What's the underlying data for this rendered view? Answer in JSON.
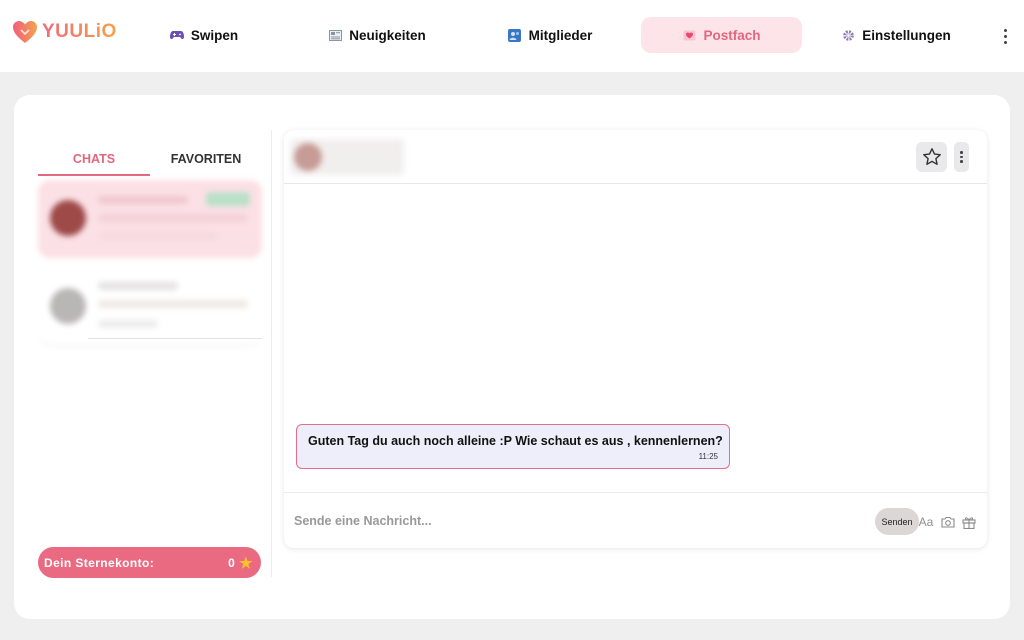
{
  "brand": {
    "name": "YUULiO"
  },
  "nav": {
    "items": [
      {
        "label": "Swipen",
        "icon": "gamepad-icon"
      },
      {
        "label": "Neuigkeiten",
        "icon": "newspaper-icon"
      },
      {
        "label": "Mitglieder",
        "icon": "members-icon"
      },
      {
        "label": "Postfach",
        "icon": "heart-letter-icon",
        "active": true
      },
      {
        "label": "Einstellungen",
        "icon": "gear-icon"
      }
    ]
  },
  "sidebar": {
    "tabs": [
      {
        "label": "CHATS",
        "active": true
      },
      {
        "label": "FAVORITEN",
        "active": false
      }
    ],
    "stars": {
      "label": "Dein Sternekonto:",
      "count": "0"
    }
  },
  "chat": {
    "message": {
      "text": "Guten Tag du auch noch alleine :P Wie schaut es aus , kennenlernen?",
      "time": "11:25"
    },
    "input": {
      "placeholder": "Sende eine Nachricht..."
    },
    "send_label": "Senden",
    "format_label": "Aa"
  },
  "colors": {
    "accent": "#e2667e",
    "active_bg": "#fde4e8",
    "star": "#f7c22a"
  }
}
